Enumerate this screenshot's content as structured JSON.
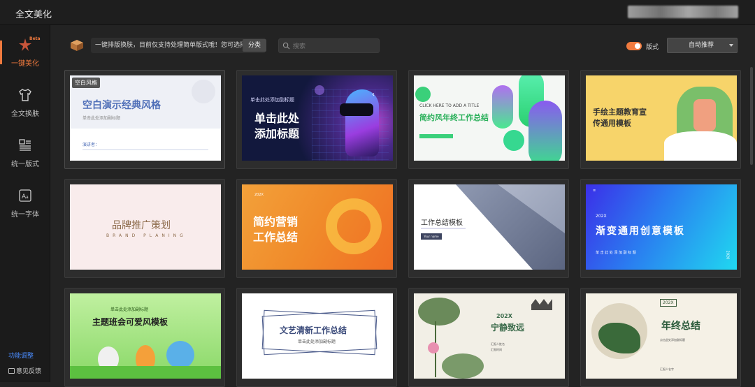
{
  "window": {
    "title": "全文美化"
  },
  "sidebar": {
    "items": [
      {
        "label": "一键美化",
        "badge": "Beta",
        "active": true,
        "icon": "magic-wand-icon"
      },
      {
        "label": "全文换肤",
        "icon": "shirt-icon"
      },
      {
        "label": "统一版式",
        "icon": "layout-icon"
      },
      {
        "label": "统一字体",
        "icon": "font-icon"
      }
    ],
    "footer": [
      {
        "label": "功能调整",
        "color": "#4a8cff"
      },
      {
        "label": "意见反馈",
        "icon": "feedback-icon"
      }
    ]
  },
  "toolbar": {
    "message": "一键排版换肤，目前仅支持处理简单版式哦！您可选择",
    "category_button": "分类",
    "search_placeholder": "搜索",
    "toggle_label": "版式",
    "dropdown_value": "自动推荐",
    "accent_color": "#f07a3e"
  },
  "templates": [
    {
      "tag": "空白风格",
      "title": "空白演示经典风格",
      "sub": "单击此处添加副标题",
      "extra": "演讲者："
    },
    {
      "title1": "单击此处",
      "title2": "添加标题",
      "sub": "单击此处添加副标题"
    },
    {
      "en": "CLICK HERE TO ADD A TITLE",
      "title": "简约风年终工作总结"
    },
    {
      "title1": "手绘主题教育宣",
      "title2": "传通用模板"
    },
    {
      "title": "品牌推广策划",
      "en": "BRAND PLANING"
    },
    {
      "title1": "简约营销",
      "title2": "工作总结",
      "year": "202X"
    },
    {
      "title": "工作总结模板",
      "btn": "Your name"
    },
    {
      "year": "202X",
      "title": "渐变通用创意模板",
      "sub": "单 击 此 处 添 加 副 标 题",
      "side": "2020"
    },
    {
      "top": "单击此处添加副标题",
      "title": "主题班会可爱风模板"
    },
    {
      "title": "文艺清新工作总结",
      "sub": "单击此处添加副标题"
    },
    {
      "year": "202X",
      "title": "宁静致远",
      "line1": "汇报人姓名",
      "line2": "汇报时间"
    },
    {
      "badge": "202X",
      "title": "年终总结",
      "sub": "点击此处添加副标题",
      "foot": "汇报人名字"
    }
  ]
}
